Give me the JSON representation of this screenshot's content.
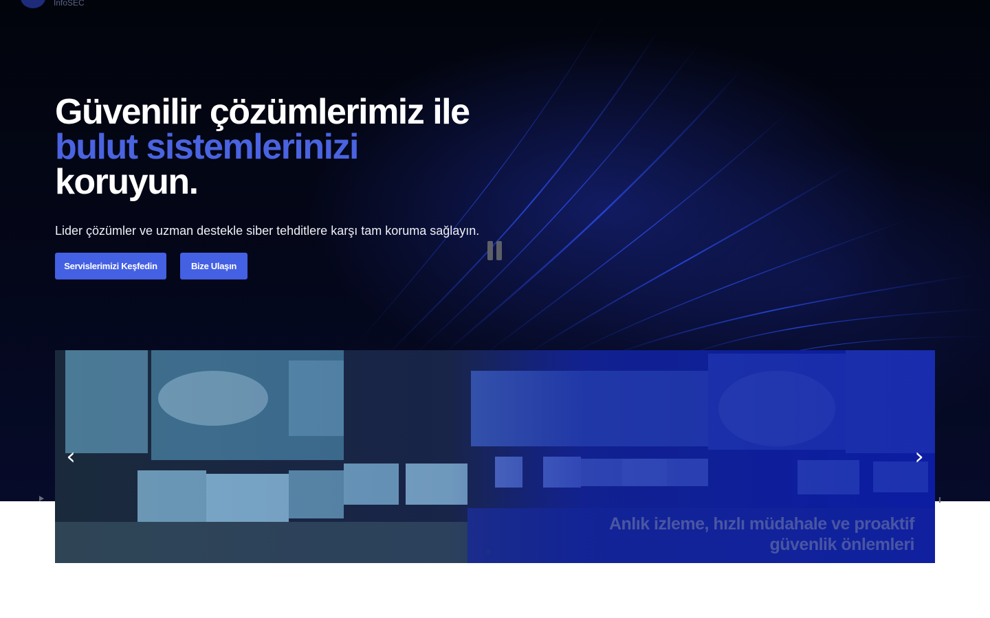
{
  "header": {
    "brand": "InfoSEC"
  },
  "hero": {
    "headline_line1": "Güvenilir çözümlerimiz ile",
    "headline_line2": "bulut sistemlerinizi",
    "headline_line3": "koruyun.",
    "subtitle": "Lider çözümler ve uzman destekle siber tehditlere karşı tam koruma sağlayın.",
    "primary_button": "Servislerimizi Keşfedin",
    "secondary_button": "Bize Ulaşın"
  },
  "slider": {
    "caption": "Anlık izleme, hızlı müdahale ve proaktif güvenlik önlemleri",
    "prev_icon": "chevron-left-icon",
    "next_icon": "chevron-right-icon",
    "pause_icon": "pause-icon"
  },
  "colors": {
    "accent": "#4a63e0",
    "button": "#4460e3",
    "hero_background": "#04071a"
  }
}
